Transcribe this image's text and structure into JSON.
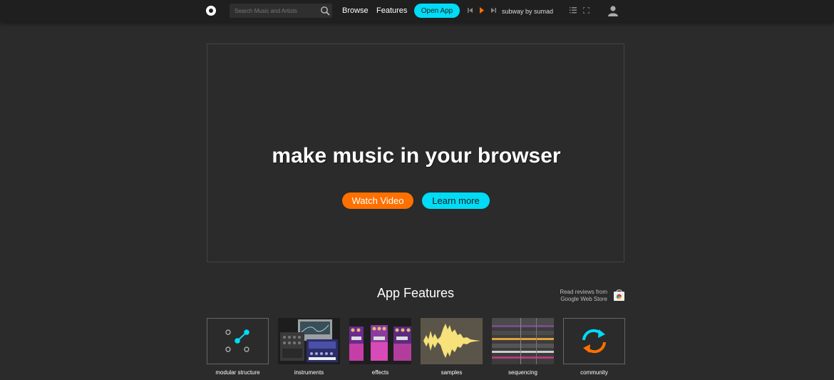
{
  "header": {
    "search_placeholder": "Search Music and Artists",
    "nav": [
      "Browse",
      "Features"
    ],
    "open_app": "Open App",
    "track": "subway by sumad",
    "accent_cyan": "#00dcf5",
    "accent_orange": "#ff7000"
  },
  "hero": {
    "title": "make music in your browser",
    "watch_video": "Watch Video",
    "learn_more": "Learn more"
  },
  "features": {
    "title": "App Features",
    "reviews_line1": "Read reviews from",
    "reviews_line2": "Google Web Store",
    "tiles": [
      {
        "label": "modular structure",
        "icon": "modular-structure-icon"
      },
      {
        "label": "instruments",
        "icon": "instruments-thumbnail"
      },
      {
        "label": "effects",
        "icon": "effects-thumbnail"
      },
      {
        "label": "samples",
        "icon": "samples-waveform"
      },
      {
        "label": "sequencing",
        "icon": "sequencing-thumbnail"
      },
      {
        "label": "community",
        "icon": "community-sync-icon"
      }
    ]
  }
}
